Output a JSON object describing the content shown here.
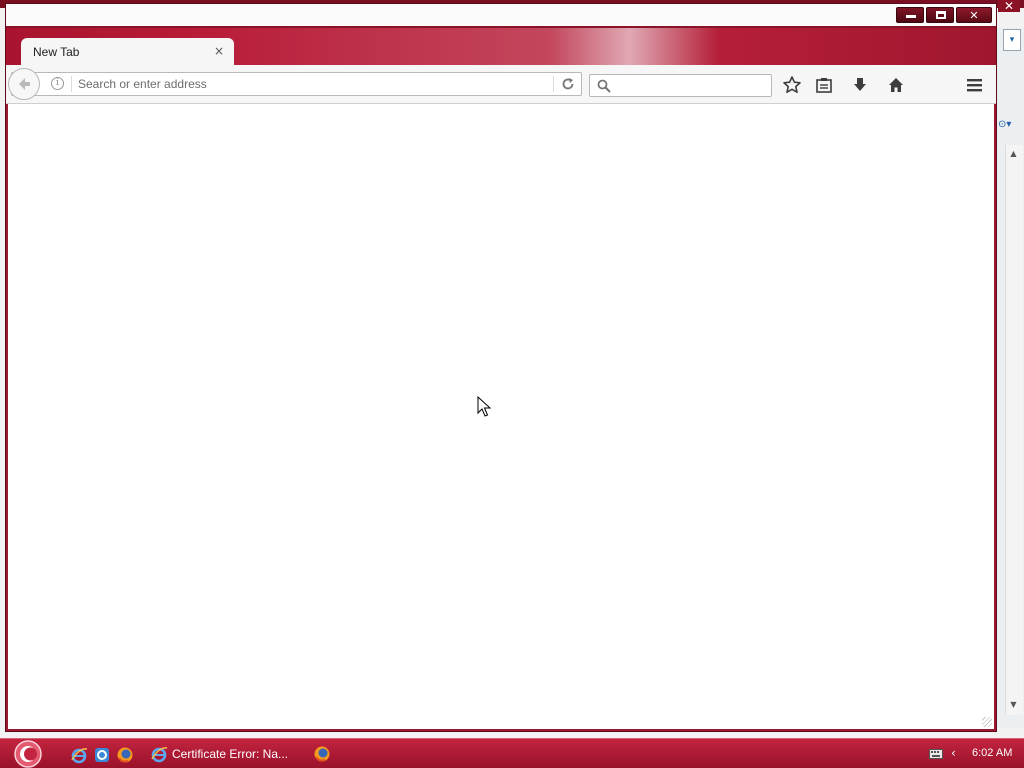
{
  "window": {
    "title": "",
    "controls": {
      "minimize": "",
      "maximize": "",
      "close": "✕"
    }
  },
  "tabs": [
    {
      "label": "New Tab",
      "active": true,
      "close": "×"
    }
  ],
  "navbar": {
    "url_placeholder": "Search or enter address",
    "url_value": "",
    "info_glyph": "i",
    "search_placeholder": "",
    "icons": [
      "back-arrow-icon",
      "info-icon",
      "reload-icon",
      "search-icon",
      "bookmark-star-icon",
      "reading-list-icon",
      "download-icon",
      "home-icon",
      "menu-hamburger-icon"
    ]
  },
  "background_window": {
    "close": "✕",
    "dropdown_arrow": "▾",
    "edge_icon": "⊙▾",
    "scroll_up": "▲",
    "scroll_down": "▼"
  },
  "taskbar": {
    "start": "start-orb",
    "quick_launch": [
      "internet-explorer-icon",
      "ie-sync-icon",
      "firefox-icon"
    ],
    "task_items": [
      {
        "label": "Certificate Error: Na...",
        "icon": "internet-explorer-icon"
      },
      {
        "label": "",
        "icon": "firefox-icon"
      }
    ],
    "tray": {
      "chevron": "‹",
      "clock": "6:02 AM"
    }
  },
  "colors": {
    "theme_red": "#a8142f",
    "taskbar_red": "#c3243f",
    "toolbar_bg": "#f6f6f6",
    "content_bg": "#ffffff"
  }
}
